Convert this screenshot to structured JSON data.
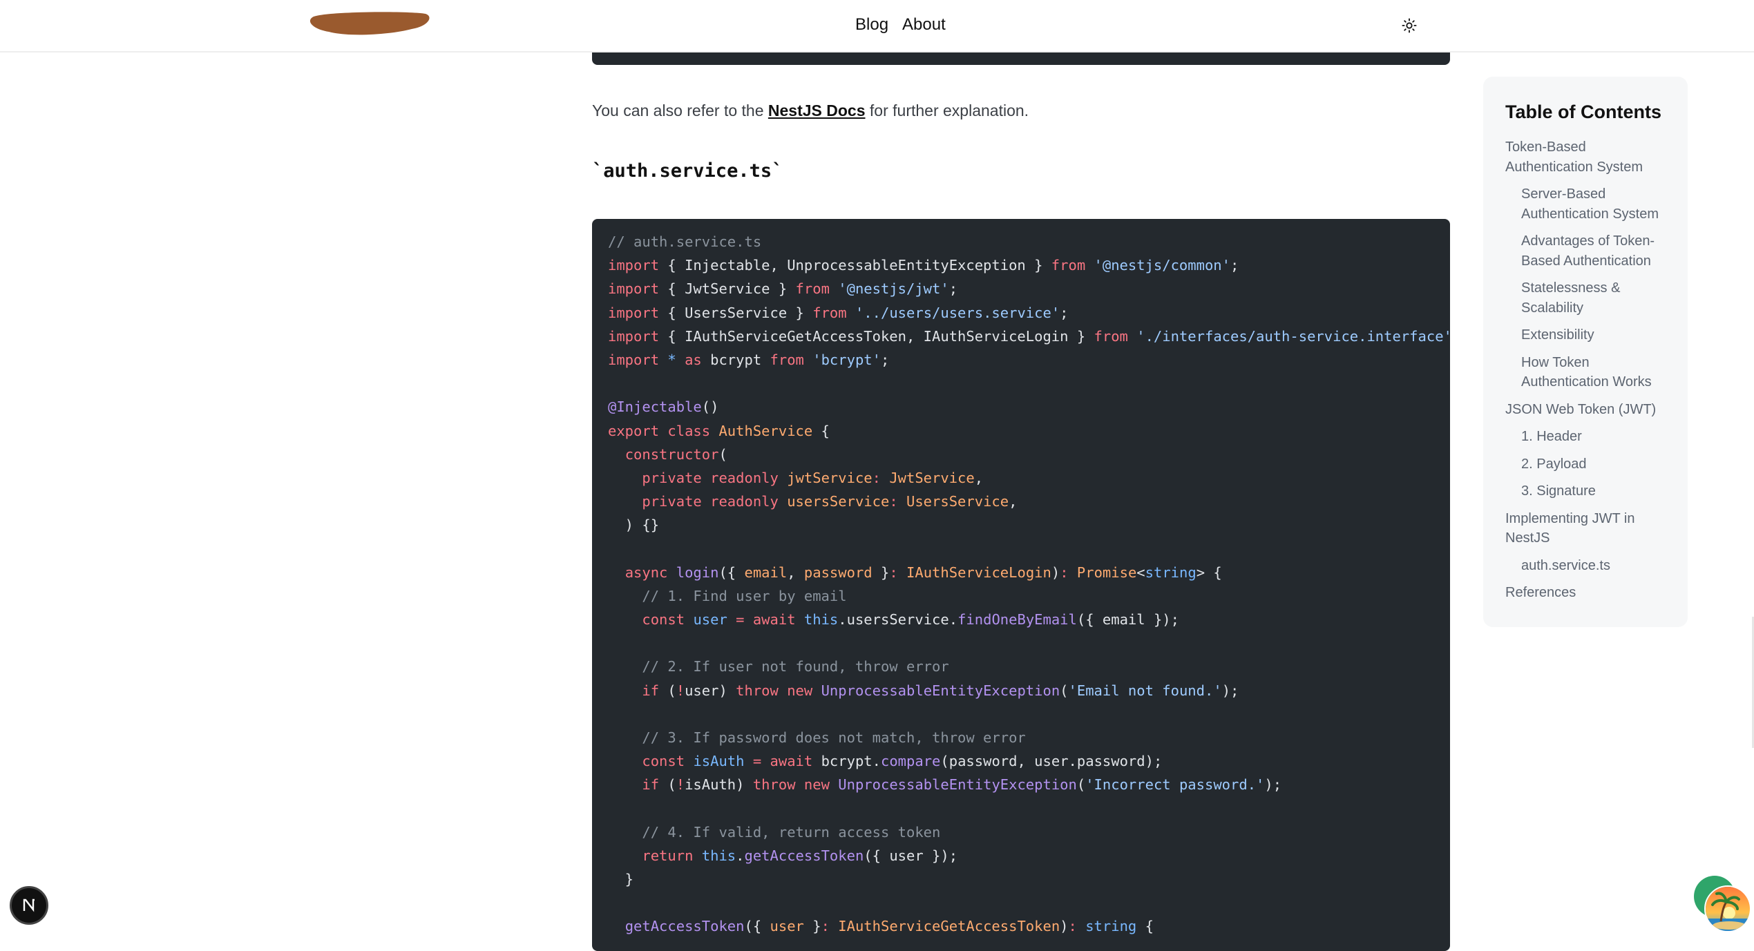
{
  "header": {
    "nav": [
      "Blog",
      "About"
    ]
  },
  "content": {
    "para_before": "You can also refer to the ",
    "para_link": "NestJS Docs",
    "para_after": " for further explanation.",
    "file_heading": "`auth.service.ts`"
  },
  "code_lines": [
    [
      [
        "cm",
        "// auth.service.ts"
      ]
    ],
    [
      [
        "kw",
        "import"
      ],
      [
        "",
        " { Injectable, UnprocessableEntityException } "
      ],
      [
        "kw",
        "from"
      ],
      [
        "",
        " "
      ],
      [
        "str",
        "'@nestjs/common'"
      ],
      [
        "",
        ";"
      ]
    ],
    [
      [
        "kw",
        "import"
      ],
      [
        "",
        " { JwtService } "
      ],
      [
        "kw",
        "from"
      ],
      [
        "",
        " "
      ],
      [
        "str",
        "'@nestjs/jwt'"
      ],
      [
        "",
        ";"
      ]
    ],
    [
      [
        "kw",
        "import"
      ],
      [
        "",
        " { UsersService } "
      ],
      [
        "kw",
        "from"
      ],
      [
        "",
        " "
      ],
      [
        "str",
        "'../users/users.service'"
      ],
      [
        "",
        ";"
      ]
    ],
    [
      [
        "kw",
        "import"
      ],
      [
        "",
        " { IAuthServiceGetAccessToken, IAuthServiceLogin } "
      ],
      [
        "kw",
        "from"
      ],
      [
        "",
        " "
      ],
      [
        "str",
        "'./interfaces/auth-service.interface'"
      ],
      [
        "",
        ";"
      ]
    ],
    [
      [
        "kw",
        "import"
      ],
      [
        "",
        " "
      ],
      [
        "cst",
        "*"
      ],
      [
        "",
        " "
      ],
      [
        "kw",
        "as"
      ],
      [
        "",
        " bcrypt "
      ],
      [
        "kw",
        "from"
      ],
      [
        "",
        " "
      ],
      [
        "str",
        "'bcrypt'"
      ],
      [
        "",
        ";"
      ]
    ],
    [],
    [
      [
        "fn",
        "@Injectable"
      ],
      [
        "",
        "()"
      ]
    ],
    [
      [
        "kw",
        "export class"
      ],
      [
        "",
        " "
      ],
      [
        "ty",
        "AuthService"
      ],
      [
        "",
        " {"
      ]
    ],
    [
      [
        "",
        "  "
      ],
      [
        "kw",
        "constructor"
      ],
      [
        "",
        "("
      ]
    ],
    [
      [
        "",
        "    "
      ],
      [
        "kw",
        "private readonly"
      ],
      [
        "",
        " "
      ],
      [
        "ty",
        "jwtService"
      ],
      [
        "kw",
        ":"
      ],
      [
        "",
        " "
      ],
      [
        "ty",
        "JwtService"
      ],
      [
        "",
        ","
      ]
    ],
    [
      [
        "",
        "    "
      ],
      [
        "kw",
        "private readonly"
      ],
      [
        "",
        " "
      ],
      [
        "ty",
        "usersService"
      ],
      [
        "kw",
        ":"
      ],
      [
        "",
        " "
      ],
      [
        "ty",
        "UsersService"
      ],
      [
        "",
        ","
      ]
    ],
    [
      [
        "",
        "  ) {}"
      ]
    ],
    [],
    [
      [
        "",
        "  "
      ],
      [
        "kw",
        "async"
      ],
      [
        "",
        " "
      ],
      [
        "fn",
        "login"
      ],
      [
        "",
        "({ "
      ],
      [
        "ty",
        "email"
      ],
      [
        "",
        ", "
      ],
      [
        "ty",
        "password"
      ],
      [
        "",
        " }"
      ],
      [
        "kw",
        ":"
      ],
      [
        "",
        " "
      ],
      [
        "ty",
        "IAuthServiceLogin"
      ],
      [
        "",
        ")"
      ],
      [
        "kw",
        ":"
      ],
      [
        "",
        " "
      ],
      [
        "ty",
        "Promise"
      ],
      [
        "",
        "<"
      ],
      [
        "cst",
        "string"
      ],
      [
        "",
        "> {"
      ]
    ],
    [
      [
        "",
        "    "
      ],
      [
        "cm",
        "// 1. Find user by email"
      ]
    ],
    [
      [
        "",
        "    "
      ],
      [
        "kw",
        "const"
      ],
      [
        "",
        " "
      ],
      [
        "cst",
        "user"
      ],
      [
        "",
        " "
      ],
      [
        "kw",
        "="
      ],
      [
        "",
        " "
      ],
      [
        "kw",
        "await"
      ],
      [
        "",
        " "
      ],
      [
        "cst",
        "this"
      ],
      [
        "",
        ".usersService."
      ],
      [
        "fn",
        "findOneByEmail"
      ],
      [
        "",
        "({ email });"
      ]
    ],
    [],
    [
      [
        "",
        "    "
      ],
      [
        "cm",
        "// 2. If user not found, throw error"
      ]
    ],
    [
      [
        "",
        "    "
      ],
      [
        "kw",
        "if"
      ],
      [
        "",
        " ("
      ],
      [
        "kw",
        "!"
      ],
      [
        "",
        "user) "
      ],
      [
        "kw",
        "throw new"
      ],
      [
        "",
        " "
      ],
      [
        "fn",
        "UnprocessableEntityException"
      ],
      [
        "",
        "("
      ],
      [
        "str",
        "'Email not found.'"
      ],
      [
        "",
        ");"
      ]
    ],
    [],
    [
      [
        "",
        "    "
      ],
      [
        "cm",
        "// 3. If password does not match, throw error"
      ]
    ],
    [
      [
        "",
        "    "
      ],
      [
        "kw",
        "const"
      ],
      [
        "",
        " "
      ],
      [
        "cst",
        "isAuth"
      ],
      [
        "",
        " "
      ],
      [
        "kw",
        "="
      ],
      [
        "",
        " "
      ],
      [
        "kw",
        "await"
      ],
      [
        "",
        " bcrypt."
      ],
      [
        "fn",
        "compare"
      ],
      [
        "",
        "(password, user.password);"
      ]
    ],
    [
      [
        "",
        "    "
      ],
      [
        "kw",
        "if"
      ],
      [
        "",
        " ("
      ],
      [
        "kw",
        "!"
      ],
      [
        "",
        "isAuth) "
      ],
      [
        "kw",
        "throw new"
      ],
      [
        "",
        " "
      ],
      [
        "fn",
        "UnprocessableEntityException"
      ],
      [
        "",
        "("
      ],
      [
        "str",
        "'Incorrect password.'"
      ],
      [
        "",
        ");"
      ]
    ],
    [],
    [
      [
        "",
        "    "
      ],
      [
        "cm",
        "// 4. If valid, return access token"
      ]
    ],
    [
      [
        "",
        "    "
      ],
      [
        "kw",
        "return"
      ],
      [
        "",
        " "
      ],
      [
        "cst",
        "this"
      ],
      [
        "",
        "."
      ],
      [
        "fn",
        "getAccessToken"
      ],
      [
        "",
        "({ user });"
      ]
    ],
    [
      [
        "",
        "  }"
      ]
    ],
    [],
    [
      [
        "",
        "  "
      ],
      [
        "fn",
        "getAccessToken"
      ],
      [
        "",
        "({ "
      ],
      [
        "ty",
        "user"
      ],
      [
        "",
        " }"
      ],
      [
        "kw",
        ":"
      ],
      [
        "",
        " "
      ],
      [
        "ty",
        "IAuthServiceGetAccessToken"
      ],
      [
        "",
        ")"
      ],
      [
        "kw",
        ":"
      ],
      [
        "",
        " "
      ],
      [
        "cst",
        "string"
      ],
      [
        "",
        " {"
      ]
    ]
  ],
  "toc": {
    "title": "Table of Contents",
    "items": [
      {
        "label": "Token-Based Authentication System",
        "level": 1
      },
      {
        "label": "Server-Based Authentication System",
        "level": 2
      },
      {
        "label": "Advantages of Token-Based Authentication",
        "level": 2
      },
      {
        "label": "Statelessness & Scalability",
        "level": 2
      },
      {
        "label": "Extensibility",
        "level": 2
      },
      {
        "label": "How Token Authentication Works",
        "level": 2
      },
      {
        "label": "JSON Web Token (JWT)",
        "level": 1
      },
      {
        "label": "1. Header",
        "level": 2
      },
      {
        "label": "2. Payload",
        "level": 2
      },
      {
        "label": "3. Signature",
        "level": 2
      },
      {
        "label": "Implementing JWT in NestJS",
        "level": 1
      },
      {
        "label": "auth.service.ts",
        "level": 2
      },
      {
        "label": "References",
        "level": 1
      }
    ]
  },
  "icons": {
    "theme": "sun-icon",
    "nextjs": "n-logo-icon",
    "avatar": "avatar-icon"
  },
  "colors": {
    "code_bg": "#24292e",
    "toc_bg": "#f6f7f8",
    "logo_blob": "#9a5a2e"
  }
}
